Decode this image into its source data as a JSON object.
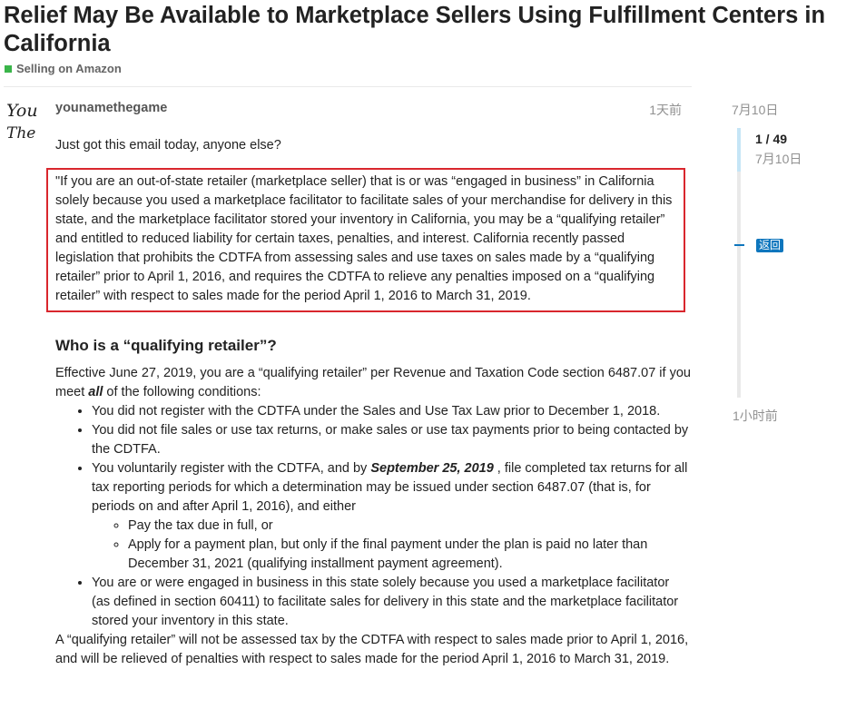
{
  "topic": {
    "title": "Relief May Be Available to Marketplace Sellers Using Fulfillment Centers in California",
    "category": "Selling on Amazon",
    "category_color": "#3ab54a"
  },
  "post": {
    "username": "younamethegame",
    "avatar_text": [
      "You",
      "The"
    ],
    "date": "1天前",
    "intro": "Just got this email today, anyone else?",
    "quote": "\"If you are an out-of-state retailer (marketplace seller) that is or was “engaged in business” in California solely because you used a marketplace facilitator to facilitate sales of your merchandise for delivery in this state, and the marketplace facilitator stored your inventory in California, you may be a “qualifying retailer” and entitled to reduced liability for certain taxes, penalties, and interest. California recently passed legislation that prohibits the CDTFA from assessing sales and use taxes on sales made by a “qualifying retailer” prior to April 1, 2016, and requires the CDTFA to relieve any penalties imposed on a “qualifying retailer” with respect to sales made for the period April 1, 2016 to March 31, 2019.",
    "quote_border_color": "#d9262d",
    "heading": "Who is a “qualifying retailer”?",
    "effective_pre": "Effective June 27, 2019, you are a “qualifying retailer” per Revenue and Taxation Code section 6487.07 if you meet ",
    "effective_em": "all",
    "effective_post": " of the following conditions:",
    "conditions": {
      "c1": "You did not register with the CDTFA under the Sales and Use Tax Law prior to December 1, 2018.",
      "c2": "You did not file sales or use tax returns, or make sales or use tax payments prior to being contacted by the CDTFA.",
      "c3_pre": "You voluntarily register with the CDTFA, and by ",
      "c3_em": "September 25, 2019",
      "c3_post": " , file completed tax returns for all tax reporting periods for which a determination may be issued under section 6487.07 (that is, for periods on and after April 1, 2016), and either",
      "c3_sub1": "Pay the tax due in full, or",
      "c3_sub2": "Apply for a payment plan, but only if the final payment under the plan is paid no later than December 31, 2021 (qualifying installment payment agreement).",
      "c4": "You are or were engaged in business in this state solely because you used a marketplace facilitator (as defined in section 60411) to facilitate sales for delivery in this state and the marketplace facilitator stored your inventory in this state."
    },
    "closing": "A “qualifying retailer” will not be assessed tax by the CDTFA with respect to sales made prior to April 1, 2016, and will be relieved of penalties with respect to sales made for the period April 1, 2016 to March 31, 2019."
  },
  "timeline": {
    "start_date": "7月10日",
    "position": "1 / 49",
    "current_date": "7月10日",
    "back_label": "返回",
    "end_label": "1小时前",
    "accent_color": "#0e76bd"
  }
}
